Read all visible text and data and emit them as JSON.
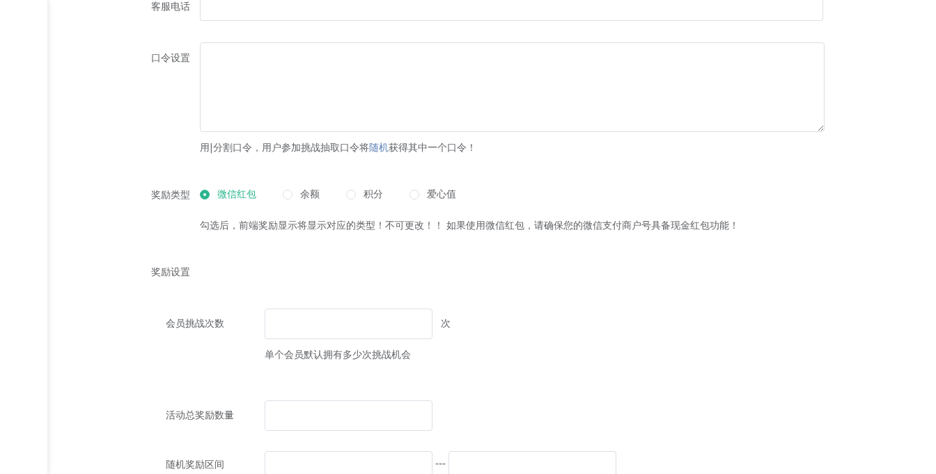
{
  "phone_field": {
    "label": "客服电话"
  },
  "password_field": {
    "label": "口令设置",
    "hint_parts": [
      {
        "text": "用|分割口令，用户参加挑战抽取口令将",
        "highlight": false
      },
      {
        "text": "随机",
        "highlight": true
      },
      {
        "text": "获得其中一个口令！",
        "highlight": false
      }
    ]
  },
  "reward_type": {
    "label": "奖励类型",
    "options": [
      {
        "label": "微信红包",
        "selected": true
      },
      {
        "label": "余额",
        "selected": false
      },
      {
        "label": "积分",
        "selected": false
      },
      {
        "label": "爱心值",
        "selected": false
      }
    ],
    "hint": "勾选后，前端奖励显示将显示对应的类型！不可更改！！ 如果使用微信红包，请确保您的微信支付商户号具备现金红包功能！"
  },
  "reward_settings": {
    "label": "奖励设置",
    "rows": [
      {
        "kind": "unit",
        "label": "会员挑战次数",
        "unit": "次",
        "hint": "单个会员默认拥有多少次挑战机会"
      },
      {
        "kind": "single",
        "label": "活动总奖励数量"
      },
      {
        "kind": "range",
        "label": "随机奖励区间",
        "separator": "---"
      }
    ]
  }
}
